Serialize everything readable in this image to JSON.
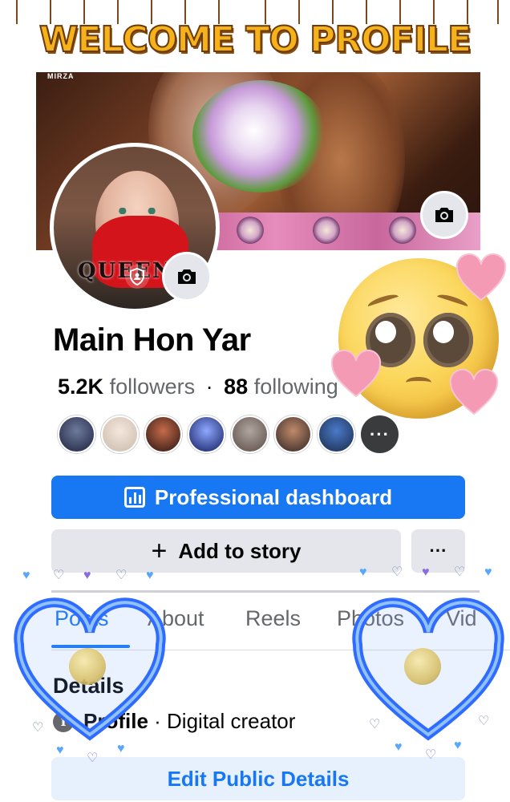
{
  "banner": {
    "title": "WELCOME TO PROFILE"
  },
  "cover": {
    "logo_text": "MIRZA"
  },
  "profile": {
    "name": "Main Hon Yar",
    "followers_count": "5.2K",
    "followers_label": "followers",
    "separator": "·",
    "following_count": "88",
    "following_label": "following",
    "avatar_overlay_text": "QUEEN",
    "more_friends_glyph": "···"
  },
  "buttons": {
    "dashboard": "Professional dashboard",
    "add_story_plus": "+",
    "add_story": "Add to story",
    "more": "···",
    "edit_details": "Edit Public Details"
  },
  "tabs": [
    "Posts",
    "About",
    "Reels",
    "Photos",
    "Vid"
  ],
  "details": {
    "heading": "Details",
    "info_icon": "i",
    "profile_label": "Profile",
    "profile_value": " · Digital creator"
  },
  "colors": {
    "accent": "#1877f2",
    "button_gray": "#e4e6eb",
    "banner_gold": "#f6b21a",
    "heart_pink": "#f49ab5",
    "glow_blue": "#2f6bff"
  },
  "icons": {
    "cover_camera": "camera-icon",
    "avatar_camera": "camera-icon",
    "shield": "profile-guard-icon",
    "dashboard": "bar-chart-icon",
    "info": "info-icon"
  }
}
